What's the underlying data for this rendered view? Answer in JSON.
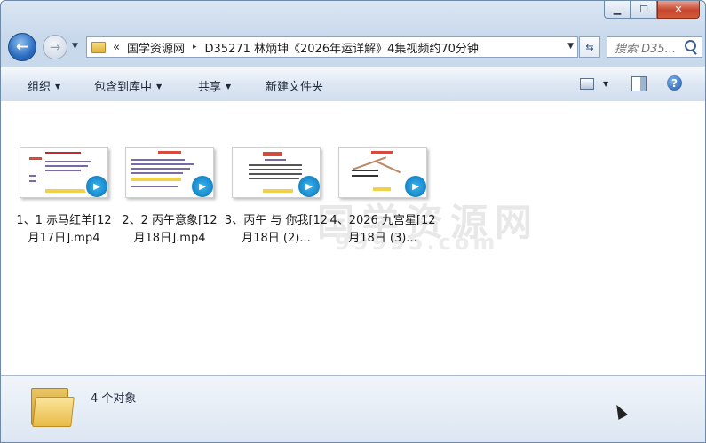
{
  "window": {
    "caption": {
      "minimize": "▁",
      "maximize": "☐",
      "close": "✕"
    }
  },
  "nav": {
    "back": "←",
    "forward": "→",
    "history_drop": "▼",
    "breadcrumb_prefix": "«",
    "breadcrumb": [
      "国学资源网",
      "D35271 林炳坤《2026年运详解》4集视频约70分钟"
    ],
    "separator": "▸",
    "address_drop": "▼",
    "refresh": "⇆",
    "search_placeholder": "搜索 D35..."
  },
  "toolbar": {
    "organize": "组织",
    "include_library": "包含到库中",
    "share": "共享",
    "new_folder": "新建文件夹",
    "help": "?"
  },
  "watermark": {
    "line1": "国学资源网",
    "line2": "99995.com"
  },
  "files": [
    {
      "label": "1、1 赤马红羊[12月17日].mp4"
    },
    {
      "label": "2、2 丙午意象[12月18日].mp4"
    },
    {
      "label": "3、丙午 与 你我[12月18日 (2)..."
    },
    {
      "label": "4、2026 九宫星[12月18日 (3)..."
    }
  ],
  "details": {
    "count": "4 个对象"
  },
  "colors": {
    "accent": "#2a6cc0",
    "play": "#1e90d6"
  }
}
